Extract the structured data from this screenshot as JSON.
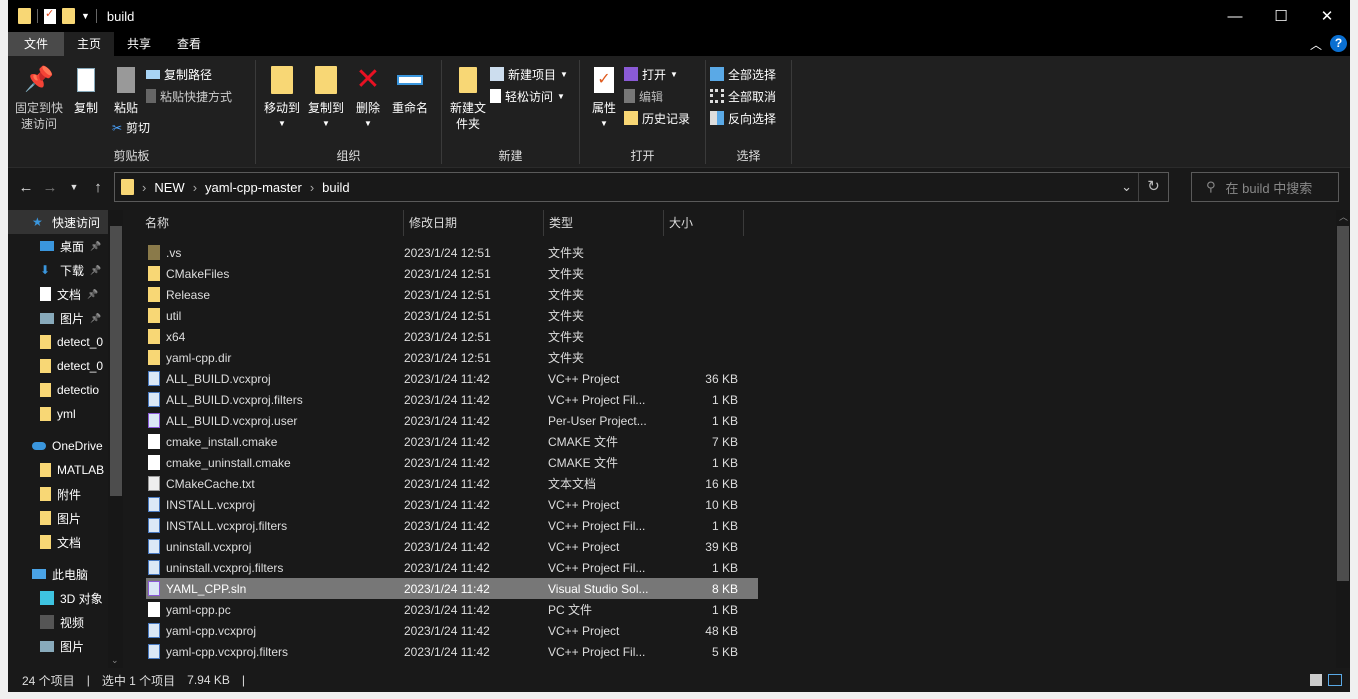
{
  "window": {
    "title": "build",
    "minimize": "—",
    "maximize": "☐",
    "close": "✕"
  },
  "tabs": [
    "文件",
    "主页",
    "共享",
    "查看"
  ],
  "ribbon": {
    "clipboard": {
      "label": "剪贴板",
      "pin": "固定到快速访问",
      "copy": "复制",
      "paste": "粘贴",
      "copy_path": "复制路径",
      "paste_shortcut": "粘贴快捷方式",
      "cut": "剪切"
    },
    "organize": {
      "label": "组织",
      "move_to": "移动到",
      "copy_to": "复制到",
      "delete": "删除",
      "rename": "重命名"
    },
    "new": {
      "label": "新建",
      "new_folder": "新建文件夹",
      "new_item": "新建项目",
      "easy_access": "轻松访问"
    },
    "open": {
      "label": "打开",
      "properties": "属性",
      "open": "打开",
      "edit": "编辑",
      "history": "历史记录"
    },
    "select": {
      "label": "选择",
      "select_all": "全部选择",
      "select_none": "全部取消",
      "invert": "反向选择"
    }
  },
  "address": {
    "crumbs": [
      "NEW",
      "yaml-cpp-master",
      "build"
    ],
    "search_placeholder": "在 build 中搜索"
  },
  "sidebar": [
    {
      "label": "快速访问",
      "icon": "star",
      "level": 0
    },
    {
      "label": "桌面",
      "icon": "desktop",
      "level": 1,
      "pinned": true
    },
    {
      "label": "下载",
      "icon": "download",
      "level": 1,
      "pinned": true
    },
    {
      "label": "文档",
      "icon": "document",
      "level": 1,
      "pinned": true
    },
    {
      "label": "图片",
      "icon": "picture",
      "level": 1,
      "pinned": true
    },
    {
      "label": "detect_0",
      "icon": "folder",
      "level": 1
    },
    {
      "label": "detect_0",
      "icon": "folder",
      "level": 1
    },
    {
      "label": "detectio",
      "icon": "folder",
      "level": 1
    },
    {
      "label": "yml",
      "icon": "folder",
      "level": 1
    },
    {
      "label": "OneDrive",
      "icon": "cloud",
      "level": 0
    },
    {
      "label": "MATLAB",
      "icon": "folder",
      "level": 1
    },
    {
      "label": "附件",
      "icon": "folder",
      "level": 1
    },
    {
      "label": "图片",
      "icon": "folder",
      "level": 1
    },
    {
      "label": "文档",
      "icon": "folder",
      "level": 1
    },
    {
      "label": "此电脑",
      "icon": "computer",
      "level": 0
    },
    {
      "label": "3D 对象",
      "icon": "cube",
      "level": 1
    },
    {
      "label": "视频",
      "icon": "video",
      "level": 1
    },
    {
      "label": "图片",
      "icon": "picture",
      "level": 1
    }
  ],
  "columns": [
    "名称",
    "修改日期",
    "类型",
    "大小"
  ],
  "files": [
    {
      "name": ".vs",
      "date": "2023/1/24 12:51",
      "type": "文件夹",
      "size": "",
      "icon": "folder-dim"
    },
    {
      "name": "CMakeFiles",
      "date": "2023/1/24 12:51",
      "type": "文件夹",
      "size": "",
      "icon": "folder"
    },
    {
      "name": "Release",
      "date": "2023/1/24 12:51",
      "type": "文件夹",
      "size": "",
      "icon": "folder"
    },
    {
      "name": "util",
      "date": "2023/1/24 12:51",
      "type": "文件夹",
      "size": "",
      "icon": "folder"
    },
    {
      "name": "x64",
      "date": "2023/1/24 12:51",
      "type": "文件夹",
      "size": "",
      "icon": "folder"
    },
    {
      "name": "yaml-cpp.dir",
      "date": "2023/1/24 12:51",
      "type": "文件夹",
      "size": "",
      "icon": "folder"
    },
    {
      "name": "ALL_BUILD.vcxproj",
      "date": "2023/1/24 11:42",
      "type": "VC++ Project",
      "size": "36 KB",
      "icon": "vcx"
    },
    {
      "name": "ALL_BUILD.vcxproj.filters",
      "date": "2023/1/24 11:42",
      "type": "VC++ Project Fil...",
      "size": "1 KB",
      "icon": "vcx"
    },
    {
      "name": "ALL_BUILD.vcxproj.user",
      "date": "2023/1/24 11:42",
      "type": "Per-User Project...",
      "size": "1 KB",
      "icon": "vs"
    },
    {
      "name": "cmake_install.cmake",
      "date": "2023/1/24 11:42",
      "type": "CMAKE 文件",
      "size": "7 KB",
      "icon": "file"
    },
    {
      "name": "cmake_uninstall.cmake",
      "date": "2023/1/24 11:42",
      "type": "CMAKE 文件",
      "size": "1 KB",
      "icon": "file"
    },
    {
      "name": "CMakeCache.txt",
      "date": "2023/1/24 11:42",
      "type": "文本文档",
      "size": "16 KB",
      "icon": "text"
    },
    {
      "name": "INSTALL.vcxproj",
      "date": "2023/1/24 11:42",
      "type": "VC++ Project",
      "size": "10 KB",
      "icon": "vcx"
    },
    {
      "name": "INSTALL.vcxproj.filters",
      "date": "2023/1/24 11:42",
      "type": "VC++ Project Fil...",
      "size": "1 KB",
      "icon": "vcx"
    },
    {
      "name": "uninstall.vcxproj",
      "date": "2023/1/24 11:42",
      "type": "VC++ Project",
      "size": "39 KB",
      "icon": "vcx"
    },
    {
      "name": "uninstall.vcxproj.filters",
      "date": "2023/1/24 11:42",
      "type": "VC++ Project Fil...",
      "size": "1 KB",
      "icon": "vcx"
    },
    {
      "name": "YAML_CPP.sln",
      "date": "2023/1/24 11:42",
      "type": "Visual Studio Sol...",
      "size": "8 KB",
      "icon": "vs",
      "selected": true
    },
    {
      "name": "yaml-cpp.pc",
      "date": "2023/1/24 11:42",
      "type": "PC 文件",
      "size": "1 KB",
      "icon": "file"
    },
    {
      "name": "yaml-cpp.vcxproj",
      "date": "2023/1/24 11:42",
      "type": "VC++ Project",
      "size": "48 KB",
      "icon": "vcx"
    },
    {
      "name": "yaml-cpp.vcxproj.filters",
      "date": "2023/1/24 11:42",
      "type": "VC++ Project Fil...",
      "size": "5 KB",
      "icon": "vcx"
    }
  ],
  "status": {
    "count": "24 个项目",
    "selected": "选中 1 个项目",
    "size": "7.94 KB"
  },
  "colors": {
    "folder": "#f8d775",
    "accent": "#0078d7",
    "selected_row": "#777777"
  }
}
